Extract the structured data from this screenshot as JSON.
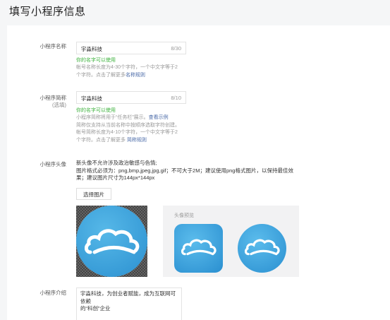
{
  "page_title": "填写小程序信息",
  "name_field": {
    "label": "小程序名称",
    "value": "宇淼科技",
    "counter": "8/30",
    "ok_text": "你的名字可以使用",
    "hint_line1": "帐号名称长度为4-30个字符，一个中文字等于2",
    "hint_line2_prefix": "个字符。点击了解更多",
    "hint_link": "名称规则"
  },
  "short_name_field": {
    "label": "小程序简称",
    "label_sub": "(选填)",
    "value": "宇淼科技",
    "counter": "8/10",
    "ok_text": "你的名字可以使用",
    "hint_line1_prefix": "小程序简称将用于“任务栏”展示。",
    "hint_line1_link": "查看示例",
    "hint_line2": "简称仅支持从当前名称中按顺序选取字符创建。",
    "hint_line3": "帐号简称长度为4-10个字符，一个中文字等于2",
    "hint_line4_prefix": "个字符。点击了解更多 ",
    "hint_link": "简称规则"
  },
  "avatar_field": {
    "label": "小程序头像",
    "desc_line1": "新头像不允许涉及政治敏感与色情;",
    "desc_line2": "图片格式必须为：png,bmp,jpeg,jpg,gif；不可大于2M；建议使用png格式图片，以保持最佳效",
    "desc_line3": "果；建议图片尺寸为144px*144px",
    "select_button": "选择图片",
    "preview_title": "头像预览"
  },
  "intro_field": {
    "label": "小程序介绍",
    "value_line1": "宇淼科技，为创业者赋能，成为互联网可依赖",
    "value_line2": "的“科创”企业"
  },
  "colors": {
    "accent_link": "#4b6ba8",
    "ok_green": "#3bb13b",
    "avatar_blue": "#2b90d0"
  }
}
